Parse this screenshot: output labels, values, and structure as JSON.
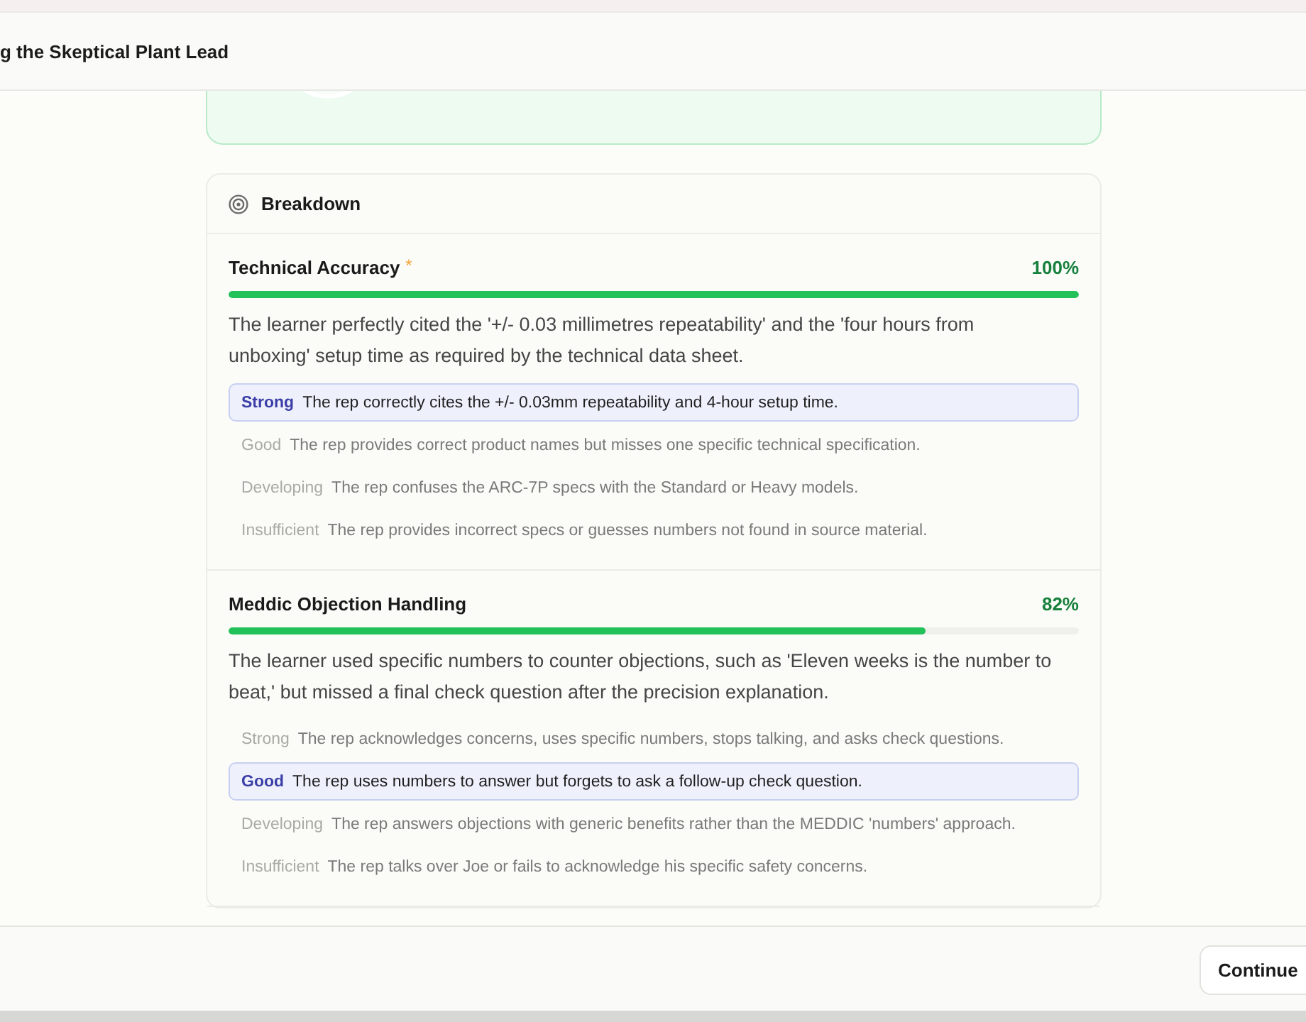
{
  "header": {
    "title": "g the Skeptical Plant Lead"
  },
  "breakdown": {
    "title": "Breakdown",
    "criteria": [
      {
        "name": "Technical Accuracy",
        "mark": "*",
        "score": "100%",
        "level": 1,
        "summary": "The learner perfectly cited the '+/- 0.03 millimetres repeatability' and the 'four hours from unboxing' setup time as required by the technical data sheet.",
        "rubric": [
          {
            "label": "Strong",
            "text": "The rep correctly cites the +/- 0.03mm repeatability and 4-hour setup time.",
            "selected": true
          },
          {
            "label": "Good",
            "text": "The rep provides correct product names but misses one specific technical specification.",
            "selected": false
          },
          {
            "label": "Developing",
            "text": "The rep confuses the ARC-7P specs with the Standard or Heavy models.",
            "selected": false
          },
          {
            "label": "Insufficient",
            "text": "The rep provides incorrect specs or guesses numbers not found in source material.",
            "selected": false
          }
        ]
      },
      {
        "name": "Meddic Objection Handling",
        "score": "82%",
        "level": 0.82,
        "summary": "The learner used specific numbers to counter objections, such as 'Eleven weeks is the number to beat,' but missed a final check question after the precision explanation.",
        "rubric": [
          {
            "label": "Strong",
            "text": "The rep acknowledges concerns, uses specific numbers, stops talking, and asks check questions.",
            "selected": false
          },
          {
            "label": "Good",
            "text": "The rep uses numbers to answer but forgets to ask a follow-up check question.",
            "selected": true
          },
          {
            "label": "Developing",
            "text": "The rep answers objections with generic benefits rather than the MEDDIC 'numbers' approach.",
            "selected": false
          },
          {
            "label": "Insufficient",
            "text": "The rep talks over Joe or fails to acknowledge his specific safety concerns.",
            "selected": false
          }
        ]
      }
    ]
  },
  "footer": {
    "button": "Continue"
  }
}
